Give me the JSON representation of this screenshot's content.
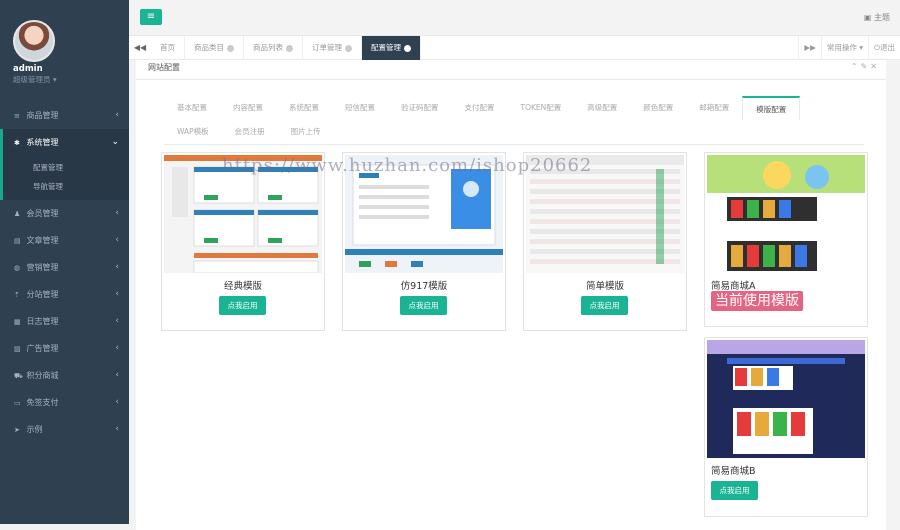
{
  "profile": {
    "name": "admin",
    "role": "超级管理员"
  },
  "sidebar": {
    "items": [
      {
        "label": "商品管理",
        "icon": "list-icon",
        "glyph": "≡"
      },
      {
        "label": "系统管理",
        "icon": "gear-icon",
        "glyph": "✱",
        "active": true
      },
      {
        "label": "会员管理",
        "icon": "users-icon",
        "glyph": "♟"
      },
      {
        "label": "文章管理",
        "icon": "copy-icon",
        "glyph": "▤"
      },
      {
        "label": "营销管理",
        "icon": "globe-icon",
        "glyph": "◍"
      },
      {
        "label": "分站管理",
        "icon": "sitemap-icon",
        "glyph": "⇡"
      },
      {
        "label": "日志管理",
        "icon": "calendar-icon",
        "glyph": "▦"
      },
      {
        "label": "广告管理",
        "icon": "image-icon",
        "glyph": "▨"
      },
      {
        "label": "积分商城",
        "icon": "cart-icon",
        "glyph": "⛟"
      },
      {
        "label": "免签支付",
        "icon": "card-icon",
        "glyph": "▭"
      },
      {
        "label": "示例",
        "icon": "send-icon",
        "glyph": "➤"
      }
    ],
    "subitems": [
      "配置管理",
      "导航管理"
    ]
  },
  "topbar": {
    "menu_glyph": "≡",
    "theme_label": "主题",
    "theme_glyph": "▣"
  },
  "tabs": [
    {
      "label": "首页",
      "closable": false
    },
    {
      "label": "商品类目",
      "closable": true
    },
    {
      "label": "商品列表",
      "closable": true
    },
    {
      "label": "订单管理",
      "closable": true
    },
    {
      "label": "配置管理",
      "closable": true,
      "active": true
    }
  ],
  "tabbar": {
    "common_ops": "常用操作",
    "logout": "退出"
  },
  "panel": {
    "title": "网站配置"
  },
  "config_tabs_row1": [
    "基本配置",
    "内容配置",
    "系统配置",
    "短信配置",
    "验证码配置",
    "支付配置",
    "TOKEN配置",
    "高级配置",
    "颜色配置",
    "邮箱配置",
    "模版配置"
  ],
  "config_tabs_row2": [
    "WAP模板",
    "会员注册",
    "图片上传"
  ],
  "active_config_tab": "模版配置",
  "templates": [
    {
      "name": "经典模版",
      "button": "点我启用"
    },
    {
      "name": "仿917模版",
      "button": "点我启用"
    },
    {
      "name": "简单模版",
      "button": "点我启用"
    },
    {
      "name": "简易商城A",
      "current_label": "当前使用模版"
    },
    {
      "name": "简易商城B",
      "button": "点我启用"
    }
  ],
  "watermark": "https://www.huzhan.com/ishop20662",
  "colors": {
    "sidebar": "#2f4050",
    "accent": "#1ab394",
    "badge": "#e36483"
  }
}
